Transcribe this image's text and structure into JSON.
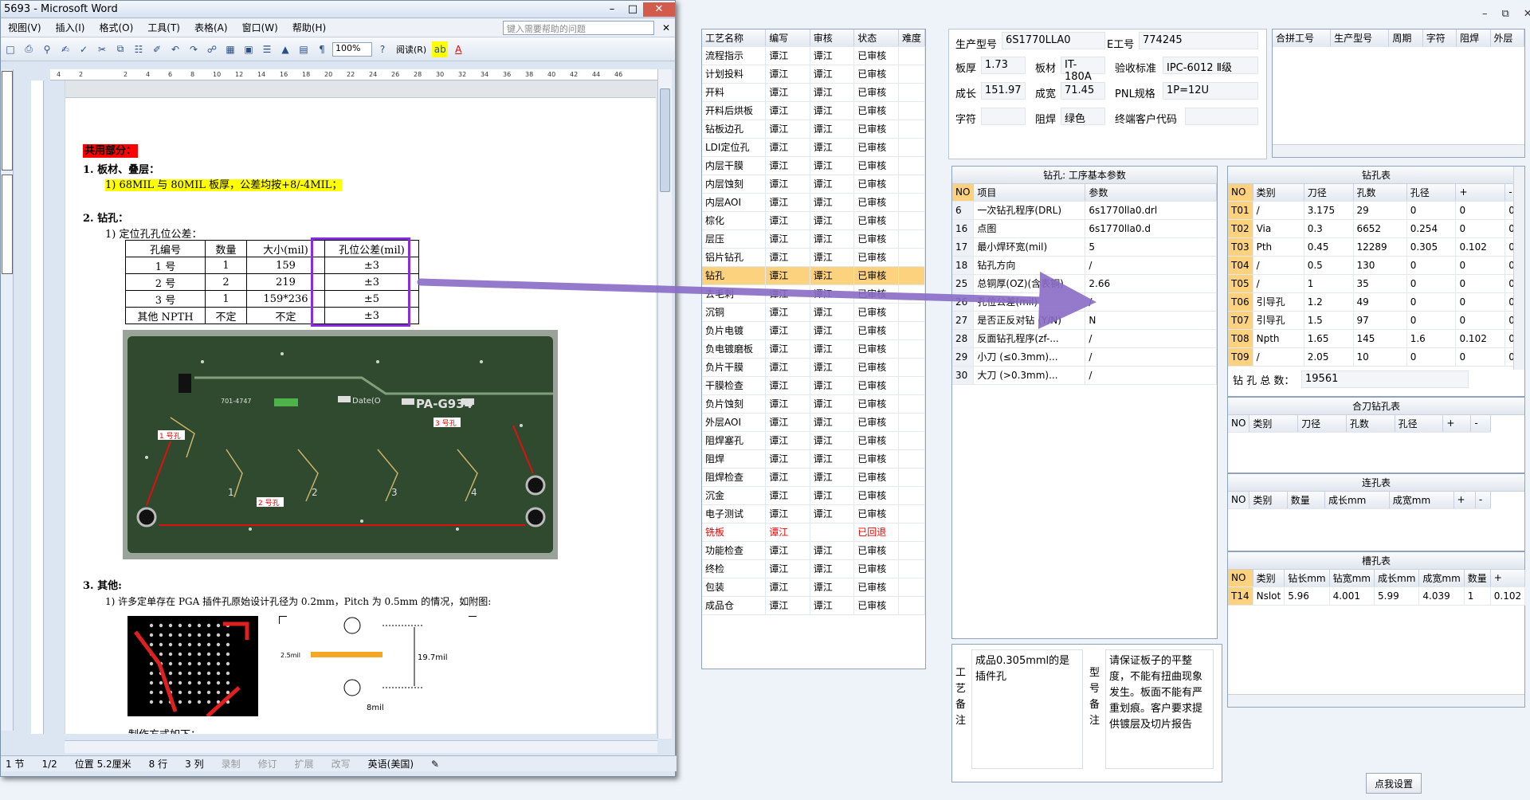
{
  "word": {
    "title": "5693 - Microsoft Word",
    "menu": [
      "视图(V)",
      "插入(I)",
      "格式(O)",
      "工具(T)",
      "表格(A)",
      "窗口(W)",
      "帮助(H)"
    ],
    "help_placeholder": "键入需要帮助的问题",
    "zoom": "100%",
    "reading": "阅读(R)",
    "ruler_ticks": [
      "4",
      "2",
      "",
      "2",
      "4",
      "6",
      "8",
      "10",
      "12",
      "14",
      "16",
      "18",
      "20",
      "22",
      "24",
      "26",
      "28",
      "30",
      "32",
      "34",
      "36",
      "38",
      "40",
      "42",
      "44",
      "46"
    ],
    "doc": {
      "section_common": "共用部分：",
      "s1_title": "1.   板材、叠层：",
      "s1_line": "1) 68MIL 与 80MIL 板厚，公差均按+8/-4MIL；",
      "s2_title": "2.   钻孔：",
      "s2_sub": "1)  定位孔孔位公差：",
      "table_headers": [
        "孔编号",
        "数量",
        "大小(mil)",
        "孔位公差(mil)"
      ],
      "table_rows": [
        [
          "1 号",
          "1",
          "159",
          "±3"
        ],
        [
          "2 号",
          "2",
          "219",
          "±3"
        ],
        [
          "3 号",
          "1",
          "159*236",
          "±5"
        ],
        [
          "其他 NPTH",
          "不定",
          "不定",
          "±3"
        ]
      ],
      "pcb_text": "PA-G934",
      "pcb_part": "701-4747",
      "pcb_brand": "Date(O",
      "hole1": "1 号孔",
      "hole2": "2 号孔",
      "hole3": "3 号孔",
      "pcb_nums": [
        "1",
        "2",
        "3",
        "4"
      ],
      "s3_title": "3.   其他:",
      "s3_line": "1)  许多定单存在 PGA 插件孔原始设计孔径为 0.2mm，Pitch 为 0.5mm 的情况，如附图:",
      "diag_a": "2.5mil",
      "diag_b": "19.7mil",
      "diag_c": "8mil",
      "method": "制作方式如下："
    },
    "status": {
      "section": "1 节",
      "pages": "1/2",
      "position": "位置 5.2厘米",
      "line": "8 行",
      "col": "3 列",
      "modes": [
        "录制",
        "修订",
        "扩展",
        "改写"
      ],
      "lang": "英语(美国)"
    }
  },
  "process": {
    "headers": [
      "工艺名称",
      "编写",
      "审核",
      "状态",
      "难度"
    ],
    "rows": [
      [
        "流程指示",
        "谭江",
        "谭江",
        "已审核"
      ],
      [
        "计划投料",
        "谭江",
        "谭江",
        "已审核"
      ],
      [
        "开料",
        "谭江",
        "谭江",
        "已审核"
      ],
      [
        "开料后烘板",
        "谭江",
        "谭江",
        "已审核"
      ],
      [
        "钻板边孔",
        "谭江",
        "谭江",
        "已审核"
      ],
      [
        "LDI定位孔",
        "谭江",
        "谭江",
        "已审核"
      ],
      [
        "内层干膜",
        "谭江",
        "谭江",
        "已审核"
      ],
      [
        "内层蚀刻",
        "谭江",
        "谭江",
        "已审核"
      ],
      [
        "内层AOI",
        "谭江",
        "谭江",
        "已审核"
      ],
      [
        "棕化",
        "谭江",
        "谭江",
        "已审核"
      ],
      [
        "层压",
        "谭江",
        "谭江",
        "已审核"
      ],
      [
        "铝片钻孔",
        "谭江",
        "谭江",
        "已审核"
      ],
      [
        "钻孔",
        "谭江",
        "谭江",
        "已审核"
      ],
      [
        "去毛刺",
        "谭江",
        "谭江",
        "已审核"
      ],
      [
        "沉铜",
        "谭江",
        "谭江",
        "已审核"
      ],
      [
        "负片电镀",
        "谭江",
        "谭江",
        "已审核"
      ],
      [
        "负电镀磨板",
        "谭江",
        "谭江",
        "已审核"
      ],
      [
        "负片干膜",
        "谭江",
        "谭江",
        "已审核"
      ],
      [
        "干膜检查",
        "谭江",
        "谭江",
        "已审核"
      ],
      [
        "负片蚀刻",
        "谭江",
        "谭江",
        "已审核"
      ],
      [
        "外层AOI",
        "谭江",
        "谭江",
        "已审核"
      ],
      [
        "阻焊塞孔",
        "谭江",
        "谭江",
        "已审核"
      ],
      [
        "阻焊",
        "谭江",
        "谭江",
        "已审核"
      ],
      [
        "阻焊检查",
        "谭江",
        "谭江",
        "已审核"
      ],
      [
        "沉金",
        "谭江",
        "谭江",
        "已审核"
      ],
      [
        "电子测试",
        "谭江",
        "谭江",
        "已审核"
      ],
      [
        "铣板",
        "谭江",
        "",
        "已回退"
      ],
      [
        "功能检查",
        "谭江",
        "谭江",
        "已审核"
      ],
      [
        "终检",
        "谭江",
        "谭江",
        "已审核"
      ],
      [
        "包装",
        "谭江",
        "谭江",
        "已审核"
      ],
      [
        "成品仓",
        "谭江",
        "谭江",
        "已审核"
      ]
    ]
  },
  "info": {
    "prod_no_label": "生产型号",
    "prod_no": "6S1770LLA0",
    "e_no_label": "E工号",
    "e_no": "774245",
    "thickness_label": "板厚",
    "thickness": "1.73",
    "material_label": "板材",
    "material": "IT-180A",
    "accept_label": "验收标准",
    "accept": "IPC-6012 Ⅱ级",
    "len_label": "成长",
    "len": "151.97",
    "wid_label": "成宽",
    "wid": "71.45",
    "pnl_label": "PNL规格",
    "pnl": "1P=12U",
    "legend_label": "字符",
    "legend": "",
    "mask_label": "阻焊",
    "mask": "绿色",
    "customer_label": "终端客户代码",
    "customer": ""
  },
  "merge": {
    "headers": [
      "合拼工号",
      "生产型号",
      "周期",
      "字符",
      "阻焊",
      "外层"
    ]
  },
  "drill_params": {
    "title": "钻孔: 工序基本参数",
    "headers": [
      "NO",
      "项目",
      "参数"
    ],
    "rows": [
      [
        "6",
        "一次钻孔程序(DRL)",
        "6s1770lla0.drl"
      ],
      [
        "16",
        "点图",
        "6s1770lla0.d"
      ],
      [
        "17",
        "最小焊环宽(mil)",
        "5"
      ],
      [
        "18",
        "钻孔方向",
        "/"
      ],
      [
        "25",
        "总铜厚(OZ)(含表铜)",
        "2.66"
      ],
      [
        "26",
        "孔位公差(mil)",
        "/"
      ],
      [
        "27",
        "是否正反对钻 (Y/N)",
        "N"
      ],
      [
        "28",
        "反面钻孔程序(zf-...",
        "/"
      ],
      [
        "29",
        "小刀 (≤0.3mm)...",
        "/"
      ],
      [
        "30",
        "大刀 (>0.3mm)...",
        "/"
      ]
    ]
  },
  "drill_table": {
    "title": "钻孔表",
    "headers": [
      "NO",
      "类别",
      "刀径",
      "孔数",
      "孔径",
      "+",
      "-"
    ],
    "rows": [
      [
        "T01",
        "/",
        "3.175",
        "29",
        "0",
        "0",
        "0"
      ],
      [
        "T02",
        "Via",
        "0.3",
        "6652",
        "0.254",
        "0",
        "0"
      ],
      [
        "T03",
        "Pth",
        "0.45",
        "12289",
        "0.305",
        "0.102",
        "0"
      ],
      [
        "T04",
        "/",
        "0.5",
        "130",
        "0",
        "0",
        "0"
      ],
      [
        "T05",
        "/",
        "1",
        "35",
        "0",
        "0",
        "0"
      ],
      [
        "T06",
        "引导孔",
        "1.2",
        "49",
        "0",
        "0",
        "0"
      ],
      [
        "T07",
        "引导孔",
        "1.5",
        "97",
        "0",
        "0",
        "0"
      ],
      [
        "T08",
        "Npth",
        "1.65",
        "145",
        "1.6",
        "0.102",
        "0"
      ],
      [
        "T09",
        "/",
        "2.05",
        "10",
        "0",
        "0",
        "0"
      ]
    ],
    "total_label": "钻 孔 总 数：",
    "total": "19561"
  },
  "combo_table": {
    "title": "合刀钻孔表",
    "headers": [
      "NO",
      "类别",
      "刀径",
      "孔数",
      "孔径",
      "+",
      "-"
    ]
  },
  "link_table": {
    "title": "连孔表",
    "headers": [
      "NO",
      "类别",
      "数量",
      "成长mm",
      "成宽mm",
      "+",
      "-"
    ]
  },
  "slot_table": {
    "title": "槽孔表",
    "headers": [
      "NO",
      "类别",
      "钻长mm",
      "钻宽mm",
      "成长mm",
      "成宽mm",
      "数量",
      "+"
    ],
    "rows": [
      [
        "T14",
        "Nslot",
        "5.96",
        "4.001",
        "5.99",
        "4.039",
        "1",
        "0.102"
      ]
    ]
  },
  "notes": {
    "process_label": "工艺备注",
    "process_text": "成品0.305mml的是插件孔",
    "model_label": "型号备注",
    "model_text": "请保证板子的平整度，不能有扭曲现象发生。板面不能有严重划痕。客户要求提供镀层及切片报告"
  },
  "settings_btn": "点我设置",
  "colors": {
    "arrow": "#8a6cc7",
    "selected_row": "#fcd27e",
    "highlight_red": "#ff0000",
    "highlight_yellow": "#ffff00"
  }
}
